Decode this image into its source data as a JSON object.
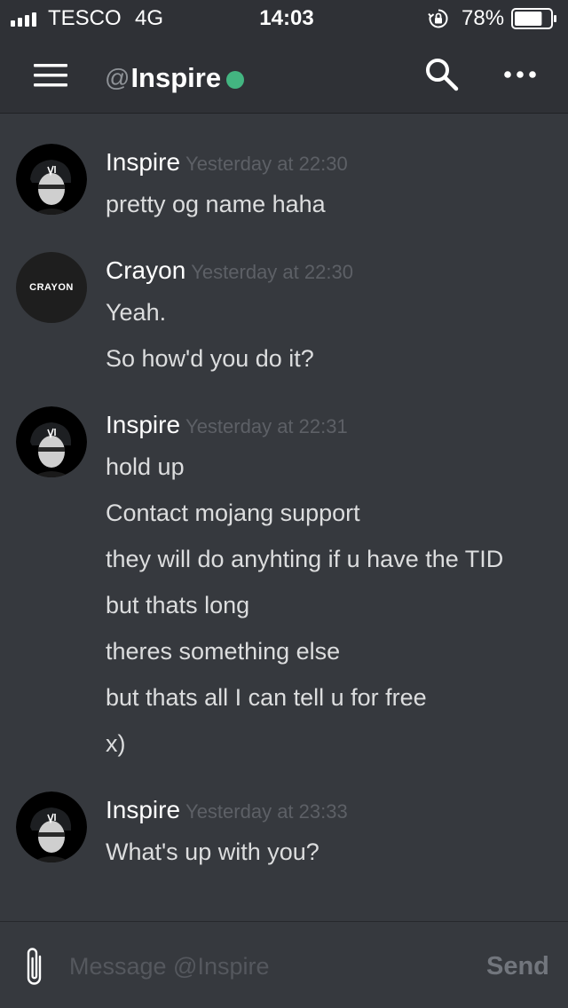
{
  "status_bar": {
    "carrier": "TESCO",
    "network": "4G",
    "time": "14:03",
    "battery_percent": "78%",
    "battery_level": 0.78
  },
  "header": {
    "at_symbol": "@",
    "channel_name": "Inspire",
    "status_color": "#43b581"
  },
  "icons": {
    "menu": "hamburger-menu-icon",
    "search": "search-icon",
    "more": "more-options-icon",
    "attach": "paperclip-icon",
    "lock": "rotation-lock-icon",
    "battery": "battery-icon",
    "signal": "signal-bars-icon"
  },
  "messages": [
    {
      "author": "Inspire",
      "timestamp": "Yesterday at 22:30",
      "lines": [
        "pretty og name haha"
      ]
    },
    {
      "author": "Crayon",
      "avatar_text": "CRAYON",
      "timestamp": "Yesterday at 22:30",
      "lines": [
        "Yeah.",
        "So how'd you do it?"
      ]
    },
    {
      "author": "Inspire",
      "timestamp": "Yesterday at 22:31",
      "lines": [
        "hold up",
        "Contact mojang support",
        "they will do anyhting if u have the TID",
        "but thats long",
        "theres something else",
        "but thats all I can tell u for free",
        "x)"
      ]
    },
    {
      "author": "Inspire",
      "timestamp": "Yesterday at 23:33",
      "lines": [
        "What's up with you?"
      ]
    }
  ],
  "composer": {
    "placeholder": "Message @Inspire",
    "value": "",
    "send_label": "Send"
  },
  "colors": {
    "background": "#36393e",
    "header_background": "#2f3136",
    "online": "#43b581",
    "timestamp": "#5d6066",
    "message_text": "#dcddde"
  }
}
